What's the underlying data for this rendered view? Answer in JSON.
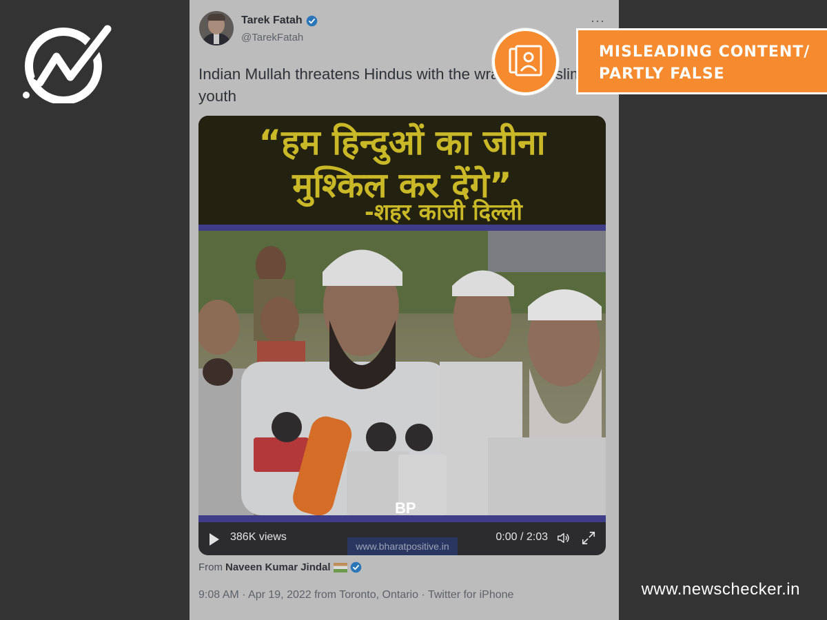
{
  "tweet": {
    "author_name": "Tarek Fatah",
    "handle": "@TarekFatah",
    "more_icon": "···",
    "text": "Indian Mullah threatens Hindus with the wrath of Muslim youth",
    "video": {
      "banner_line1": "“हम हिन्दुओं का जीना",
      "banner_line2": "मुश्किल कर देंगे”",
      "banner_line3": "-शहर काजी दिल्ली",
      "views": "386K views",
      "time": "0:00 / 2:03",
      "watermark": "www.bharatpositive.in",
      "channel_logo": "BP"
    },
    "from_prefix": "From",
    "from_name": "Naveen Kumar Jindal",
    "meta": "9:08 AM · Apr 19, 2022 from Toronto, Ontario · Twitter for iPhone"
  },
  "overlay": {
    "rating_line1": "MISLEADING CONTENT/",
    "rating_line2": "PARTLY FALSE",
    "site_url": "www.newschecker.in"
  },
  "colors": {
    "background": "#333334",
    "badge": "#f58b2e",
    "verified": "#1d9bf0"
  }
}
